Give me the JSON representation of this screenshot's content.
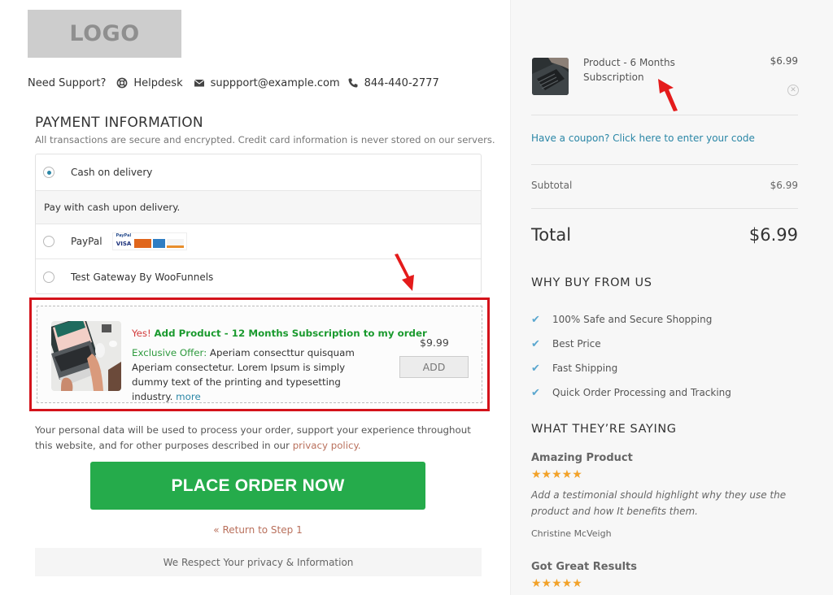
{
  "header": {
    "logo_text": "LOGO",
    "support": {
      "label": "Need Support?",
      "helpdesk": "Helpdesk",
      "email": "suppport@example.com",
      "phone": "844-440-2777"
    }
  },
  "payment": {
    "title": "PAYMENT INFORMATION",
    "subtitle": "All transactions are secure and encrypted. Credit card information is never stored on our servers.",
    "methods": [
      {
        "label": "Cash on delivery",
        "selected": true,
        "description": "Pay with cash upon delivery."
      },
      {
        "label": "PayPal",
        "selected": false,
        "card_icons": [
          "PayPal",
          "VISA",
          "MasterCard",
          "AMEX",
          "DISCOVER"
        ]
      },
      {
        "label": "Test Gateway By WooFunnels",
        "selected": false
      }
    ]
  },
  "order_bump": {
    "yes": "Yes!",
    "headline": "Add Product - 12 Months Subscription to my order",
    "offer_label": "Exclusive Offer:",
    "offer_text": "Aperiam consecttur quisquam Aperiam consectetur. Lorem Ipsum is simply dummy text of the printing and typesetting industry.",
    "more_link": "more",
    "price": "$9.99",
    "add_button": "ADD"
  },
  "privacy": {
    "text": "Your personal data will be used to process your order, support your experience throughout this website, and for other purposes described in our",
    "link": "privacy policy."
  },
  "actions": {
    "place_order": "PLACE ORDER NOW",
    "return_link": "« Return to Step 1",
    "respect_note": "We Respect Your privacy & Information"
  },
  "summary": {
    "product": {
      "name": "Product - 6 Months Subscription",
      "price": "$6.99"
    },
    "coupon_link": "Have a coupon? Click here to enter your code",
    "subtotal_label": "Subtotal",
    "subtotal_value": "$6.99",
    "total_label": "Total",
    "total_value": "$6.99"
  },
  "why_buy": {
    "title": "WHY BUY FROM US",
    "items": [
      "100% Safe and Secure Shopping",
      "Best Price",
      "Fast Shipping",
      "Quick Order Processing and Tracking"
    ]
  },
  "testimonials": {
    "title": "WHAT THEY’RE SAYING",
    "items": [
      {
        "heading": "Amazing Product",
        "stars": "★★★★★",
        "rating": 5,
        "body": "Add a testimonial should highlight why they use the product and how It benefits them.",
        "author": "Christine McVeigh"
      },
      {
        "heading": "Got Great Results",
        "stars": "★★★★★",
        "rating": 5
      }
    ]
  },
  "colors": {
    "accent_green": "#25ab4b",
    "highlight_red": "#d4131b",
    "link_blue": "#2a86a6",
    "link_brown": "#b9705c",
    "star_orange": "#f2a22a"
  }
}
